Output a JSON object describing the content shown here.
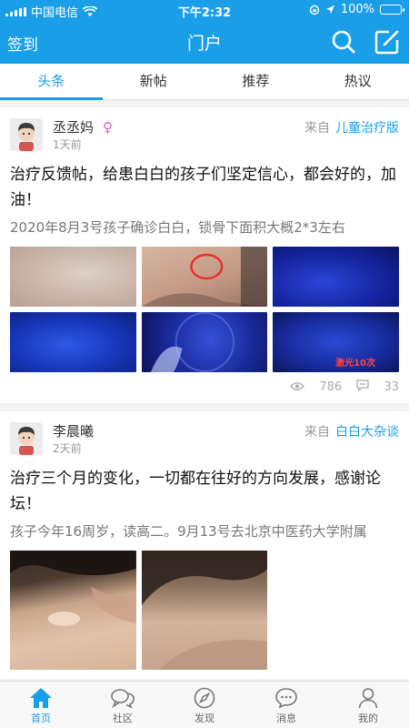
{
  "status_bar": {
    "carrier": "中国电信",
    "time": "下午2:32",
    "battery": "100%"
  },
  "nav": {
    "left_label": "签到",
    "title": "门户"
  },
  "tabs": [
    {
      "label": "头条",
      "active": true
    },
    {
      "label": "新帖",
      "active": false
    },
    {
      "label": "推荐",
      "active": false
    },
    {
      "label": "热议",
      "active": false
    }
  ],
  "posts": [
    {
      "author": "丞丞妈",
      "gender_icon": "female-icon",
      "time": "1天前",
      "source_prefix": "来自",
      "forum": "儿童治疗版",
      "title": "治疗反馈帖，给患白白的孩子们坚定信心，都会好的，加油！",
      "excerpt": "2020年8月3号孩子确诊白白，锁骨下面积大概2*3左右",
      "image_caption": "激光10次",
      "views": "786",
      "replies": "33"
    },
    {
      "author": "李晨曦",
      "time": "2天前",
      "source_prefix": "来自",
      "forum": "白白大杂谈",
      "title": "治疗三个月的变化，一切都在往好的方向发展，感谢论坛！",
      "excerpt": "孩子今年16周岁，读高二。9月13号去北京中医药大学附属"
    }
  ],
  "tabbar": [
    {
      "label": "首页",
      "icon": "home-icon",
      "active": true
    },
    {
      "label": "社区",
      "icon": "community-icon",
      "active": false
    },
    {
      "label": "发现",
      "icon": "compass-icon",
      "active": false
    },
    {
      "label": "消息",
      "icon": "message-icon",
      "active": false
    },
    {
      "label": "我的",
      "icon": "profile-icon",
      "active": false
    }
  ],
  "colors": {
    "accent": "#1a9ee8",
    "female": "#e35cc5"
  }
}
